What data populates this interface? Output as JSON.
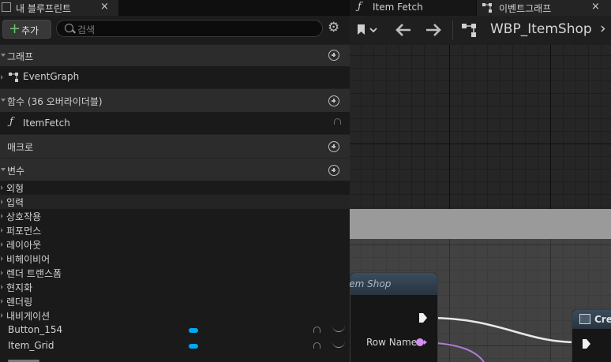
{
  "left_panel": {
    "tab_title": "내 블루프린트",
    "close": "×",
    "add_label": "추가",
    "search_placeholder": "검색",
    "sections": {
      "graphs": "그래프",
      "functions": "함수 (36 오버라이더블)",
      "macros": "매크로",
      "variables": "변수"
    },
    "event_graph": "EventGraph",
    "item_fetch": "ItemFetch",
    "categories": [
      "외형",
      "입력",
      "상호작용",
      "퍼포먼스",
      "레이아웃",
      "비헤이비어",
      "렌더 트랜스폼",
      "현지화",
      "렌더링",
      "내비게이션"
    ],
    "variables": [
      {
        "name": "Button_154",
        "type_color": "#00a8f0"
      },
      {
        "name": "Item_Grid",
        "type_color": "#00a8f0"
      }
    ]
  },
  "right_panel": {
    "tab_item_fetch": "Item Fetch",
    "tab_event_graph": "이벤트그래프",
    "close": "×",
    "breadcrumb": "WBP_ItemShop",
    "node_title": "Item Shop",
    "row_name": "Row Name",
    "node2_title": "Cre"
  }
}
